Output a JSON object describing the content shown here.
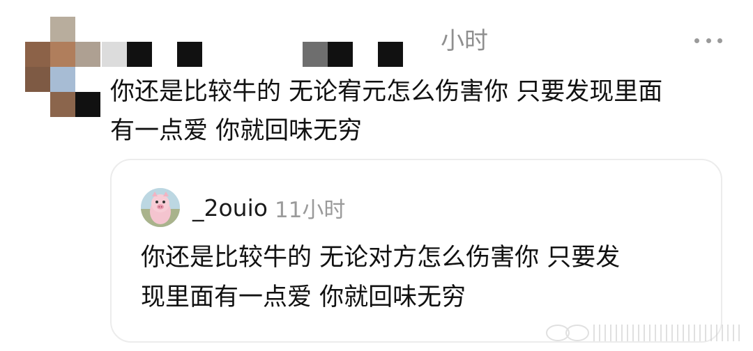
{
  "post": {
    "time_label": "小时",
    "body_lines": [
      "你还是比较牛的 无论宥元怎么伤害你 只要发现里面",
      "有一点爱 你就回味无穷"
    ]
  },
  "quote": {
    "username": "_2ouio",
    "time_label": "11小时",
    "body_lines": [
      "你还是比较牛的 无论对方怎么伤害你 只要发",
      "现里面有一点爱 你就回味无穷"
    ]
  },
  "icons": {
    "more": "more-dots-icon",
    "avatar": "pig-avatar-icon",
    "watermark": "weibo-watermark"
  },
  "colors": {
    "secondary_text": "#8f8f8f",
    "card_border": "#ececec"
  }
}
